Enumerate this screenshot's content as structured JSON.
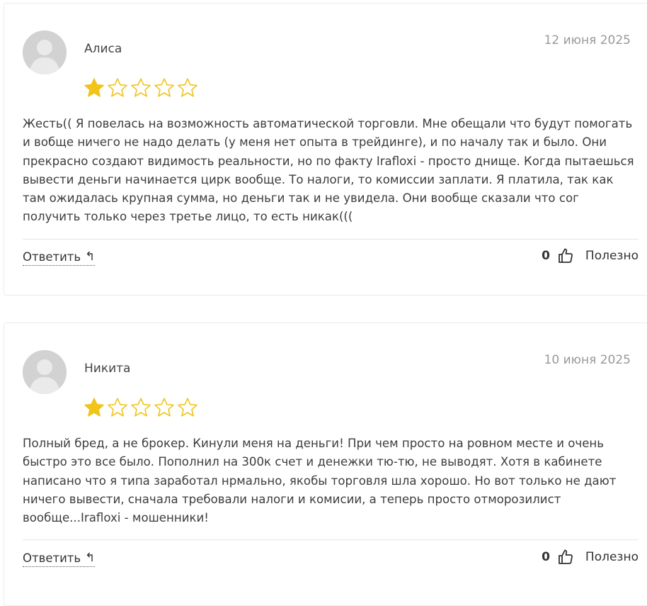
{
  "reviews": [
    {
      "author": "Алиса",
      "date": "12 июня 2025",
      "rating": 1,
      "max_rating": 5,
      "text": "Жесть(( Я повелась на возможность автоматической торговли. Мне обещали что будут помогать и вобще ничего не надо делать (у меня нет опыта в трейдинге), и по началу так и было. Они прекрасно создают видимость реальности, но по факту Irafloxi - просто днище. Когда пытаешься вывести деньги начинается цирк вообще. То налоги, то комиссии заплати. Я платила, так как там ожидалась крупная сумма, но деньги так и не увидела. Они вообще сказали что сог получить только через третье лицо, то есть никак(((",
      "reply_label": "Ответить",
      "helpful_count": "0",
      "helpful_label": "Полезно"
    },
    {
      "author": "Никита",
      "date": "10 июня 2025",
      "rating": 1,
      "max_rating": 5,
      "text": "Полный бред, а не брокер. Кинули меня на деньги! При чем просто на ровном месте и очень быстро это все было. Пополнил на 300к счет и денежки тю-тю, не выводят. Хотя в кабинете написано что я типа заработал нрмально, якобы торговля шла хорошо. Но вот только не дают ничего вывести, сначала требовали налоги и комисии, а теперь просто отморозилист вообще...Irafloxi - мошенники!",
      "reply_label": "Ответить",
      "helpful_count": "0",
      "helpful_label": "Полезно"
    }
  ],
  "icons": {
    "avatar": "user-silhouette-icon",
    "star_filled": "star-filled-icon",
    "star_empty": "star-outline-icon",
    "reply": "reply-arrow-icon",
    "thumb": "thumbs-up-icon"
  },
  "colors": {
    "star": "#f0c419",
    "date": "#999999",
    "text": "#3d3d3d",
    "avatar_bg": "#cfcfcf"
  }
}
